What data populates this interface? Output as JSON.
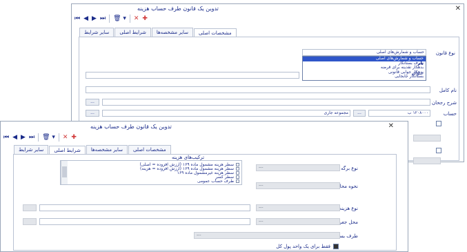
{
  "back_window": {
    "title": "تدوین یک قانون طرف حساب هزینه",
    "close": "✕",
    "toolbar": {
      "first": "⏮",
      "prev": "◀",
      "next": "▶",
      "last": "⏭",
      "filter": "🗑 ▾",
      "cancel": "✕",
      "save": "✚"
    },
    "tabs": [
      "مشخصات اصلی",
      "سایر مشخصه‌ها",
      "شرایط اصلی",
      "سایر شرایط"
    ],
    "labels": {
      "law_type": "نوع قانون",
      "name": "نام",
      "title_field": "عنوان",
      "main_name": "نام کامل",
      "description": "شرح رجحان",
      "account": "حساب"
    },
    "dropdown": {
      "selected": "حساب و شمارش‌های اصلی",
      "options": [
        "حساب و شمارش‌های اصلی",
        "طرف بستانکار",
        "بدهکار نقدینه برای قرضه",
        "بدهکار جوابی قانونی",
        "بستانکار جابجایی"
      ]
    },
    "account_values": {
      "amount": "۱۲۰۸۰۰۰ ب",
      "cur": "...",
      "note": "مجموعه جاری"
    },
    "btn_dots": "..."
  },
  "front_window": {
    "title": "تدوین یک قانون طرف حساب هزینه",
    "close": "✕",
    "toolbar": {
      "first": "⏮",
      "prev": "◀",
      "next": "▶",
      "last": "⏭",
      "filter": "🗑 ▾",
      "cancel": "✕",
      "save": "✚"
    },
    "tabs": [
      "مشخصات اصلی",
      "سایر مشخصه‌ها",
      "شرایط اصلی",
      "سایر شرایط"
    ],
    "group_title": "ترکیب‌های هزینه",
    "labels": {
      "doc_type": "نوع برگه",
      "calc_type": "نحوه محاسبه",
      "cost_type": "نوع هزینه",
      "cost_center": "محل جغرافیایی",
      "creditor": "طرف بستانکار",
      "checkbox": "فقط برای یک واحد پول کل"
    },
    "list_items": [
      "سطر هزینه مشمول ماده ۱۶۹ (ارزش افزوده = اصلی)",
      "سطر هزینه مشمول ماده ۱۶۹ (ارزش افزوده = هزینه)",
      "سطر هزینه غیرمشمول ماده ۱۶۹",
      "سطر کسر",
      "طرف حساب عمومی"
    ],
    "field_placeholder": "---"
  }
}
